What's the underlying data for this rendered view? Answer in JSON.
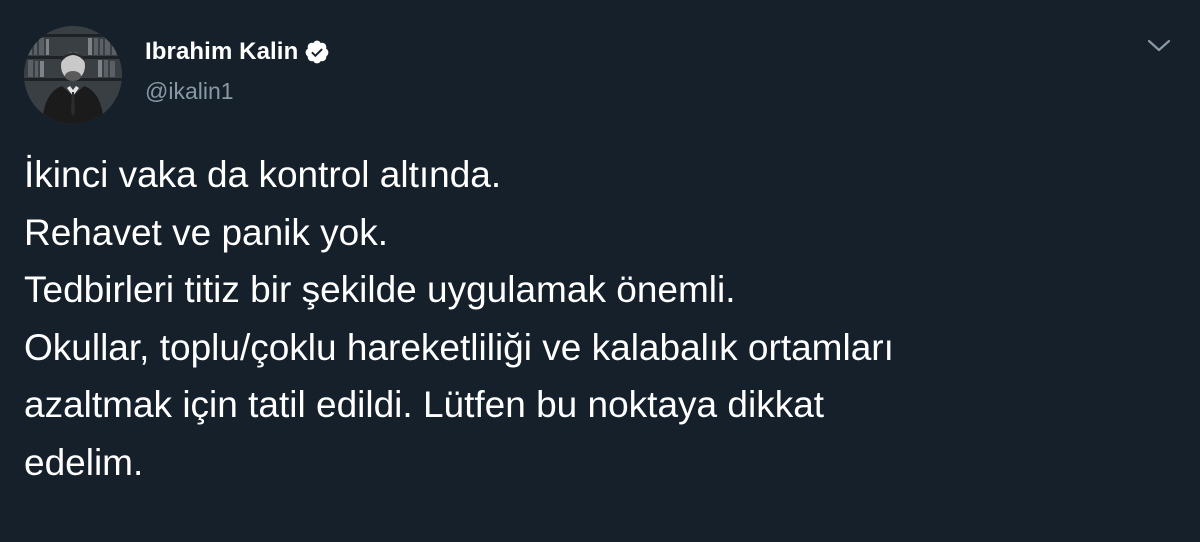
{
  "author": {
    "display_name": "Ibrahim Kalin",
    "handle": "@ikalin1",
    "verified": true,
    "avatar_icon": "profile-photo"
  },
  "tweet": {
    "lines": [
      "İkinci vaka da kontrol altında.",
      "Rehavet ve panik yok.",
      "Tedbirleri titiz bir şekilde uygulamak önemli.",
      "Okullar, toplu/çoklu hareketliliği ve kalabalık ortamları",
      "azaltmak için tatil edildi. Lütfen bu noktaya dikkat",
      "edelim."
    ]
  },
  "colors": {
    "background": "#15202b",
    "text": "#ffffff",
    "secondary_text": "#8899a6",
    "verified_badge": "#ffffff"
  },
  "icons": {
    "verified": "verified-badge-icon",
    "more": "chevron-down-icon"
  }
}
